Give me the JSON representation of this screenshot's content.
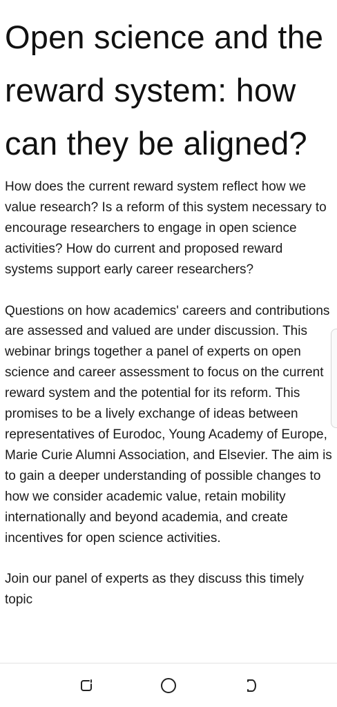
{
  "article": {
    "title": "Open science and the reward system: how can they be aligned?",
    "paragraphs": [
      "How does the current reward system reflect how we value research? Is a reform of this system necessary to encourage researchers to engage in open science activities? How do current and proposed reward systems support early career researchers?",
      "Questions on how academics' careers and contributions are assessed and valued are under discussion. This webinar brings together a panel of experts on open science and career assessment to focus on the current reward system and the potential for its reform. This promises to be a lively exchange of ideas between representatives of Eurodoc, Young Academy of Europe, Marie Curie Alumni Association, and Elsevier. The aim is to gain a deeper understanding of possible changes to how we consider academic value, retain mobility internationally and beyond academia, and create incentives for open science activities.",
      "Join our panel of experts as they discuss this timely topic"
    ]
  },
  "nav_bar": {
    "recent_apps_icon": "recent-apps-icon",
    "home_icon": "home-icon",
    "back_icon": "back-icon"
  }
}
